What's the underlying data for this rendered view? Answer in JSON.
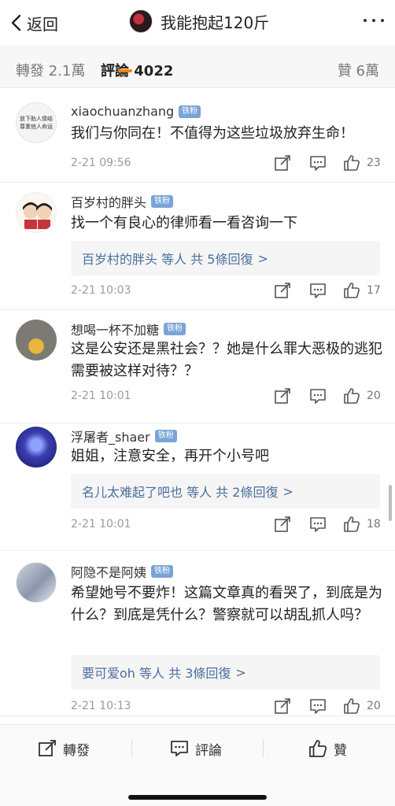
{
  "header": {
    "back_label": "返回",
    "title": "我能抱起120斤",
    "icons": [
      "chevron-left-icon",
      "more-icon"
    ]
  },
  "tabs": {
    "repost": "轉發 2.1萬",
    "comment": "評論 4022",
    "like": "贊 6萬",
    "accent_color": "#ff8200"
  },
  "badge_label": "铁粉",
  "comments": [
    {
      "username": "xiaochuanzhang",
      "avatar_text": [
        "放下助人情结",
        "尊重他人命运"
      ],
      "content": "我们与你同在！不值得为这些垃圾放弃生命！",
      "replies": "",
      "time": "2-21 09:56",
      "likes": "23"
    },
    {
      "username": "百岁村的胖头",
      "content": "找一个有良心的律师看一看咨询一下",
      "replies": "百岁村的胖头 等人 共 5條回復",
      "time": "2-21 10:03",
      "likes": "17"
    },
    {
      "username": "想喝一杯不加糖",
      "content": "这是公安还是黑社会？？她是什么罪大恶极的逃犯需要被这样对待？？",
      "replies": "",
      "time": "2-21 10:01",
      "likes": "20"
    },
    {
      "username": "浮屠者_shaer",
      "content": "姐姐，注意安全，再开个小号吧",
      "replies": "名儿太难起了吧也 等人 共 2條回復",
      "time": "2-21 10:01",
      "likes": "18"
    },
    {
      "username": "阿隐不是阿姨",
      "content": "希望她号不要炸！这篇文章真的看哭了，到底是为什么？到底是凭什么？警察就可以胡乱抓人吗？",
      "replies": "要可爱oh 等人 共 3條回復",
      "time": "2-21 10:13",
      "likes": "20"
    }
  ],
  "reply_arrow": ">",
  "bottom_bar": {
    "repost": "轉發",
    "comment": "評論",
    "like": "贊"
  },
  "colors": {
    "link": "#4a6f9e",
    "badge": "#7aa4d8",
    "muted": "#9a9a9a"
  }
}
